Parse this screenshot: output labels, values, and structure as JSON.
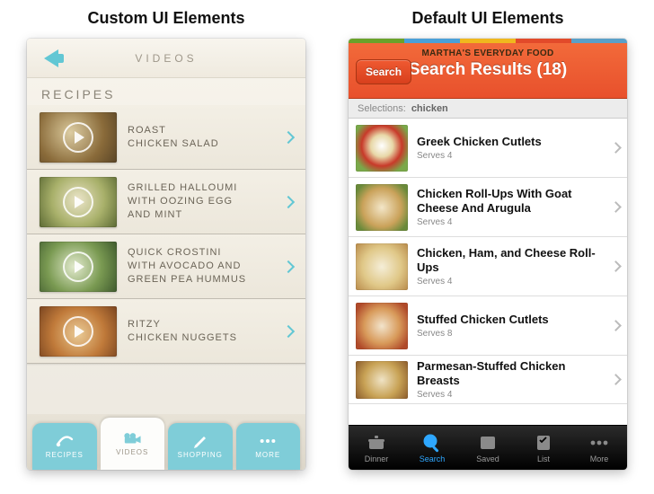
{
  "columns": {
    "left_title": "Custom UI Elements",
    "right_title": "Default UI Elements"
  },
  "left": {
    "header_title": "VIDEOS",
    "section_label": "RECIPES",
    "recipes": [
      {
        "title": "ROAST\nCHICKEN SALAD"
      },
      {
        "title": "GRILLED HALLOUMI\nWITH OOZING EGG\nAND MINT"
      },
      {
        "title": "QUICK CROSTINI\nWITH AVOCADO AND\nGREEN PEA HUMMUS"
      },
      {
        "title": "RITZY\nCHICKEN NUGGETS"
      }
    ],
    "tabs": [
      {
        "label": "RECIPES"
      },
      {
        "label": "VIDEOS"
      },
      {
        "label": "SHOPPING"
      },
      {
        "label": "MORE"
      }
    ],
    "active_tab_index": 1
  },
  "right": {
    "stripe_colors": [
      "#6aa22a",
      "#4aa0d8",
      "#f0b81e",
      "#e24a2a",
      "#5aa0c8"
    ],
    "app_name": "MARTHA'S EVERYDAY FOOD",
    "title": "Search Results (18)",
    "search_button": "Search",
    "selections_label": "Selections:",
    "selections_value": "chicken",
    "results": [
      {
        "name": "Greek Chicken Cutlets",
        "serves": "Serves 4"
      },
      {
        "name": "Chicken Roll-Ups With Goat Cheese And Arugula",
        "serves": "Serves 4"
      },
      {
        "name": "Chicken, Ham, and Cheese Roll-Ups",
        "serves": "Serves 4"
      },
      {
        "name": "Stuffed Chicken Cutlets",
        "serves": "Serves 8"
      },
      {
        "name": "Parmesan-Stuffed Chicken Breasts",
        "serves": "Serves 4"
      }
    ],
    "tabs": [
      {
        "label": "Dinner"
      },
      {
        "label": "Search"
      },
      {
        "label": "Saved"
      },
      {
        "label": "List"
      },
      {
        "label": "More"
      }
    ],
    "active_tab_index": 1
  }
}
